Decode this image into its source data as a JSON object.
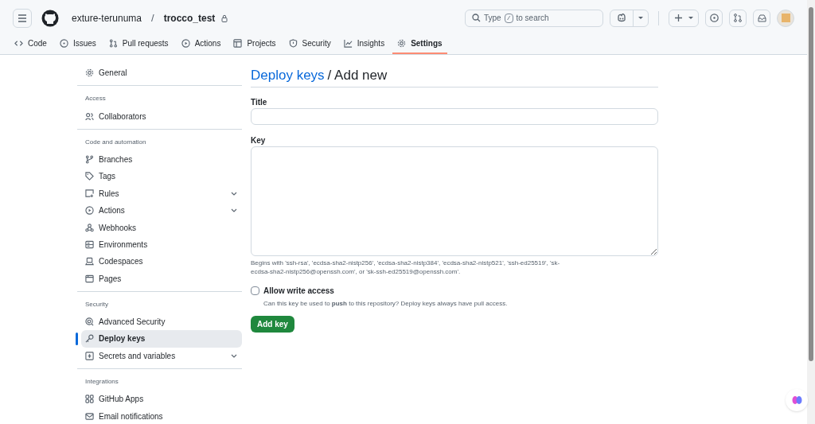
{
  "header": {
    "owner": "exture-terunuma",
    "separator": "/",
    "repo": "trocco_test",
    "search": {
      "before": "Type",
      "key": "/",
      "after": "to search"
    }
  },
  "tabs": [
    {
      "label": "Code",
      "selected": false
    },
    {
      "label": "Issues",
      "selected": false
    },
    {
      "label": "Pull requests",
      "selected": false
    },
    {
      "label": "Actions",
      "selected": false
    },
    {
      "label": "Projects",
      "selected": false
    },
    {
      "label": "Security",
      "selected": false
    },
    {
      "label": "Insights",
      "selected": false
    },
    {
      "label": "Settings",
      "selected": true
    }
  ],
  "sidebar": {
    "sections": [
      {
        "items": [
          {
            "label": "General",
            "expandable": false,
            "selected": false
          }
        ]
      },
      {
        "heading": "Access",
        "items": [
          {
            "label": "Collaborators",
            "expandable": false,
            "selected": false
          }
        ]
      },
      {
        "heading": "Code and automation",
        "items": [
          {
            "label": "Branches",
            "expandable": false,
            "selected": false
          },
          {
            "label": "Tags",
            "expandable": false,
            "selected": false
          },
          {
            "label": "Rules",
            "expandable": true,
            "selected": false
          },
          {
            "label": "Actions",
            "expandable": true,
            "selected": false
          },
          {
            "label": "Webhooks",
            "expandable": false,
            "selected": false
          },
          {
            "label": "Environments",
            "expandable": false,
            "selected": false
          },
          {
            "label": "Codespaces",
            "expandable": false,
            "selected": false
          },
          {
            "label": "Pages",
            "expandable": false,
            "selected": false
          }
        ]
      },
      {
        "heading": "Security",
        "items": [
          {
            "label": "Advanced Security",
            "expandable": false,
            "selected": false
          },
          {
            "label": "Deploy keys",
            "expandable": false,
            "selected": true
          },
          {
            "label": "Secrets and variables",
            "expandable": true,
            "selected": false
          }
        ]
      },
      {
        "heading": "Integrations",
        "items": [
          {
            "label": "GitHub Apps",
            "expandable": false,
            "selected": false
          },
          {
            "label": "Email notifications",
            "expandable": false,
            "selected": false
          }
        ]
      }
    ]
  },
  "main": {
    "title_link": "Deploy keys",
    "title_rest": "/ Add new",
    "title_field": {
      "label": "Title"
    },
    "key_field": {
      "label": "Key"
    },
    "key_hint": "Begins with 'ssh-rsa', 'ecdsa-sha2-nistp256', 'ecdsa-sha2-nistp384', 'ecdsa-sha2-nistp521', 'ssh-ed25519', 'sk-ecdsa-sha2-nistp256@openssh.com', or 'sk-ssh-ed25519@openssh.com'.",
    "write_access": {
      "label": "Allow write access",
      "checked": false,
      "description": "Can this key be used to **push** to this repository? Deploy keys always have pull access."
    },
    "submit": "Add key"
  }
}
